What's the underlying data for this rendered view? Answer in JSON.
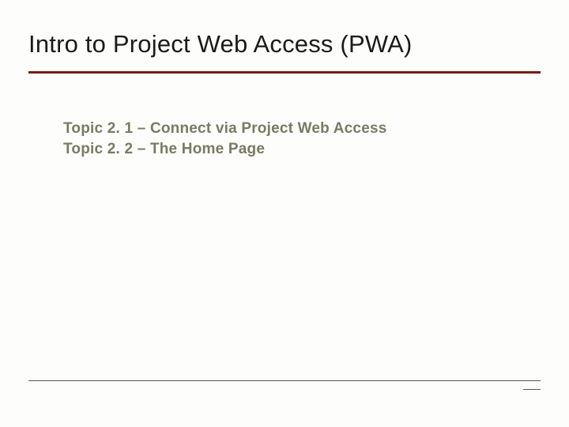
{
  "title": "Intro to Project Web Access (PWA)",
  "topics": [
    "Topic 2. 1 – Connect via Project Web Access",
    "Topic 2. 2 – The Home Page"
  ]
}
